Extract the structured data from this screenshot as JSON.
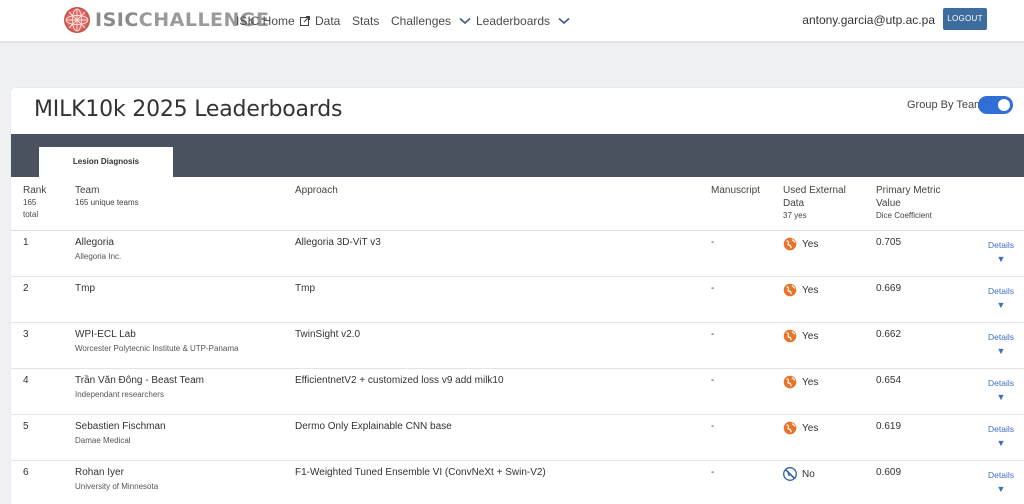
{
  "nav": {
    "logo_left": "ISIC",
    "logo_right": "CHALLENGE",
    "links": [
      {
        "label": "ISIC Home",
        "icon": "external-link-icon"
      },
      {
        "label": "Data"
      },
      {
        "label": "Stats"
      },
      {
        "label": "Challenges",
        "icon": "chevron-down-icon"
      },
      {
        "label": "Leaderboards",
        "icon": "chevron-down-icon"
      }
    ],
    "user_email": "antony.garcia@utp.ac.pa",
    "logout_label": "LOGOUT"
  },
  "page": {
    "title": "MILK10k 2025 Leaderboards",
    "group_by_label": "Group By Team",
    "group_by_enabled": true,
    "tabs": [
      {
        "label": "Lesion Diagnosis",
        "active": true
      }
    ]
  },
  "table": {
    "headers": {
      "rank": "Rank",
      "rank_sub": "165",
      "rank_sub2": "total",
      "team": "Team",
      "team_sub": "165 unique teams",
      "approach": "Approach",
      "manuscript": "Manuscript",
      "external": "Used External",
      "external2": "Data",
      "external_sub": "37 yes",
      "metric": "Primary Metric",
      "metric2": "Value",
      "metric_sub": "Dice Coefficient"
    },
    "rows": [
      {
        "rank": "1",
        "team": "Allegoria",
        "org": "Allegoria Inc.",
        "approach": "Allegoria 3D-ViT v3",
        "manuscript": "-",
        "external": "Yes",
        "external_icon": "globe-icon",
        "metric": "0.705",
        "details": "Details"
      },
      {
        "rank": "2",
        "team": "Tmp",
        "org": "",
        "approach": "Tmp",
        "manuscript": "-",
        "external": "Yes",
        "external_icon": "globe-icon",
        "metric": "0.669",
        "details": "Details"
      },
      {
        "rank": "3",
        "team": "WPI-ECL Lab",
        "org": "Worcester Polytecnic Institute & UTP-Panama",
        "approach": "TwinSight v2.0",
        "manuscript": "-",
        "external": "Yes",
        "external_icon": "globe-icon",
        "metric": "0.662",
        "details": "Details"
      },
      {
        "rank": "4",
        "team": "Trần Văn Đông - Beast Team",
        "org": "Independant researchers",
        "approach": "EfficientnetV2 + customized loss v9 add milk10",
        "manuscript": "-",
        "external": "Yes",
        "external_icon": "globe-icon",
        "metric": "0.654",
        "details": "Details"
      },
      {
        "rank": "5",
        "team": "Sebastien Fischman",
        "org": "Damae Medical",
        "approach": "Dermo Only Explainable CNN base",
        "manuscript": "-",
        "external": "Yes",
        "external_icon": "globe-icon",
        "metric": "0.619",
        "details": "Details"
      },
      {
        "rank": "6",
        "team": "Rohan Iyer",
        "org": "University of Minnesota",
        "approach": "F1-Weighted Tuned Ensemble VI (ConvNeXt + Swin-V2)",
        "manuscript": "-",
        "external": "No",
        "external_icon": "globe-blocked-icon",
        "metric": "0.609",
        "details": "Details"
      }
    ]
  },
  "colors": {
    "accent": "#2f6fd6",
    "tabbar": "#4a5260",
    "globe_yes": "#e8742a",
    "globe_no": "#2f5fa8",
    "logout": "#3d6c9e"
  }
}
